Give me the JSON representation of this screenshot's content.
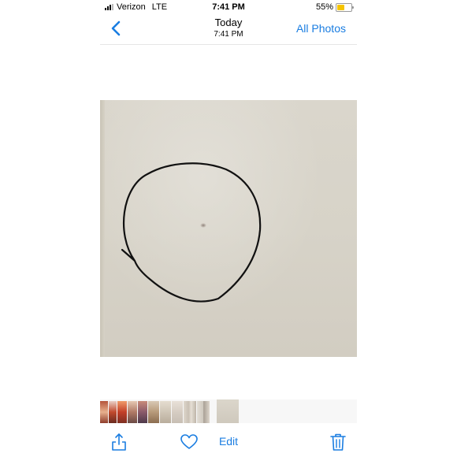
{
  "status_bar": {
    "carrier": "Verizon",
    "network": "LTE",
    "time": "7:41 PM",
    "battery_percent_label": "55%",
    "battery_level": 0.55
  },
  "nav": {
    "title": "Today",
    "subtitle": "7:41 PM",
    "all_photos_label": "All Photos"
  },
  "toolbar": {
    "edit_label": "Edit"
  },
  "icons": {
    "back": "chevron-left-icon",
    "share": "share-icon",
    "favorite": "heart-icon",
    "delete": "trash-icon"
  },
  "colors": {
    "accent": "#1a7de1",
    "battery_fill": "#f5c400"
  },
  "thumbnail_strip": {
    "count": 11,
    "selected_index": 10
  }
}
